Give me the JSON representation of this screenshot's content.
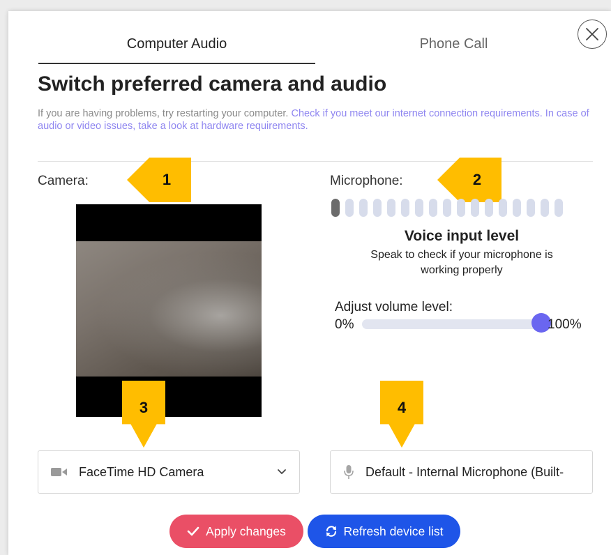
{
  "tabs": {
    "computer_audio": "Computer Audio",
    "phone_call": "Phone Call"
  },
  "dialog": {
    "title": "Switch preferred camera and audio",
    "help_text_plain": "If you are having problems, try restarting your computer. ",
    "help_link_internet": "Check if you meet our internet connection requirements.",
    "help_link_hardware": " In case of audio or video issues, take a look at hardware requirements."
  },
  "camera": {
    "label": "Camera:",
    "selected_device": "FaceTime HD Camera",
    "icon": "video-camera-icon"
  },
  "microphone": {
    "label": "Microphone:",
    "selected_device": "Default - Internal Microphone (Built-",
    "icon": "microphone-icon",
    "level_bars_total": 17,
    "level_bars_active": 1,
    "voice_title": "Voice input level",
    "voice_subtitle_line1": "Speak to check if your microphone is",
    "voice_subtitle_line2": "working properly"
  },
  "volume": {
    "label": "Adjust volume level:",
    "min_label": "0%",
    "max_label": "100%",
    "value_percent": 100
  },
  "callouts": [
    "1",
    "2",
    "3",
    "4"
  ],
  "buttons": {
    "apply": "Apply changes",
    "refresh": "Refresh device list"
  },
  "colors": {
    "accent_purple": "#6a66f0",
    "link_purple": "#8f86f0",
    "apply_red": "#ea4f66",
    "refresh_blue": "#1e55e8",
    "callout_yellow": "#ffbd00",
    "meter_inactive": "#d7dceb",
    "meter_active": "#6c6c6c"
  },
  "icons": {
    "close": "close-icon",
    "check": "check-icon",
    "refresh": "refresh-icon",
    "chevron": "chevron-down-icon"
  }
}
